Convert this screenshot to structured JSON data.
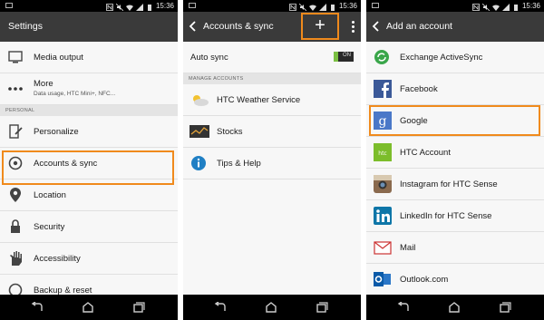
{
  "status_bar": {
    "time": "15:36"
  },
  "colors": {
    "accent_orange": "#f08a1c",
    "action_bar": "#3a3a3a",
    "toggle_green": "#7bc043"
  },
  "screen1": {
    "title": "Settings",
    "items": [
      {
        "label": "Media output",
        "icon": "media-output-icon"
      },
      {
        "label": "More",
        "sub": "Data usage, HTC Mini+, NFC...",
        "icon": "more-dots-icon"
      },
      {
        "label": "Personalize",
        "icon": "personalize-icon"
      },
      {
        "label": "Accounts & sync",
        "icon": "accounts-sync-icon"
      },
      {
        "label": "Location",
        "icon": "location-icon"
      },
      {
        "label": "Security",
        "icon": "lock-icon"
      },
      {
        "label": "Accessibility",
        "icon": "hand-icon"
      },
      {
        "label": "Backup & reset",
        "icon": "backup-icon"
      }
    ],
    "section_label": "PERSONAL"
  },
  "screen2": {
    "title": "Accounts & sync",
    "plus_label": "+",
    "auto_sync_label": "Auto sync",
    "auto_sync_state": "ON",
    "section_label": "MANAGE ACCOUNTS",
    "items": [
      {
        "label": "HTC Weather Service",
        "icon": "weather-icon"
      },
      {
        "label": "Stocks",
        "icon": "stocks-icon"
      },
      {
        "label": "Tips & Help",
        "icon": "info-icon"
      }
    ]
  },
  "screen3": {
    "title": "Add an account",
    "items": [
      {
        "label": "Exchange ActiveSync",
        "icon": "exchange-icon"
      },
      {
        "label": "Facebook",
        "icon": "facebook-icon"
      },
      {
        "label": "Google",
        "icon": "google-icon"
      },
      {
        "label": "HTC Account",
        "icon": "htc-icon"
      },
      {
        "label": "Instagram for HTC Sense",
        "icon": "instagram-icon"
      },
      {
        "label": "LinkedIn for HTC Sense",
        "icon": "linkedin-icon"
      },
      {
        "label": "Mail",
        "icon": "mail-icon"
      },
      {
        "label": "Outlook.com",
        "icon": "outlook-icon"
      }
    ]
  }
}
